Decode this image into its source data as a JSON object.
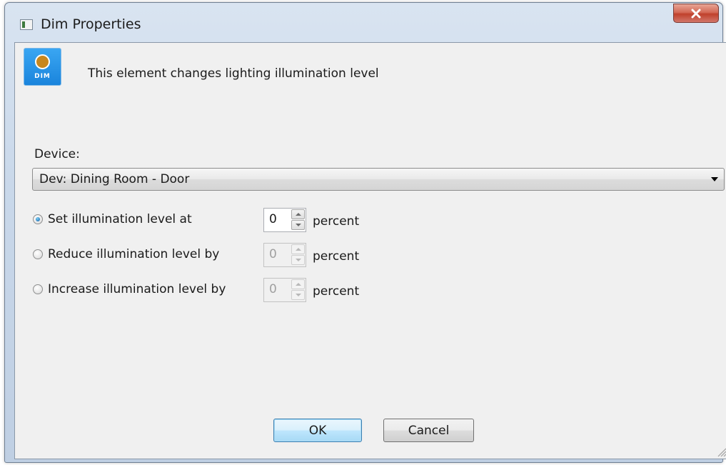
{
  "window": {
    "title": "Dim Properties"
  },
  "header": {
    "icon_text": "DIM",
    "description": "This element changes lighting illumination level"
  },
  "device": {
    "label": "Device:",
    "selected": "Dev: Dining Room - Door"
  },
  "options": [
    {
      "label": "Set illumination level at",
      "value": "0",
      "unit": "percent",
      "checked": true,
      "enabled": true
    },
    {
      "label": "Reduce illumination level by",
      "value": "0",
      "unit": "percent",
      "checked": false,
      "enabled": false
    },
    {
      "label": "Increase illumination level by",
      "value": "0",
      "unit": "percent",
      "checked": false,
      "enabled": false
    }
  ],
  "buttons": {
    "ok": "OK",
    "cancel": "Cancel"
  },
  "colors": {
    "close_button": "#c8452f",
    "icon_background": "#1f8ae0",
    "client_background": "#f0f0f0"
  },
  "icons": [
    "window-icon",
    "close-icon",
    "dim-icon",
    "dropdown-arrow-icon",
    "spin-up-icon",
    "spin-down-icon",
    "resize-grip-icon"
  ]
}
